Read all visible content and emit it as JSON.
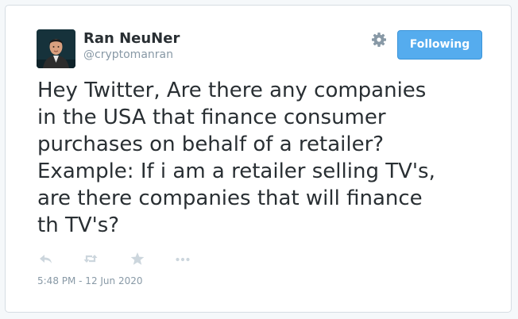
{
  "author": {
    "name": "Ran NeuNer",
    "handle": "@cryptomanran"
  },
  "follow_button": {
    "label": "Following"
  },
  "tweet": {
    "text": "Hey Twitter, Are there any companies\nin the USA that finance consumer\npurchases on behalf of a retailer?\nExample: If i am a retailer selling TV's,\nare there companies that will finance\nth TV's?",
    "timestamp": "5:48 PM - 12 Jun 2020"
  },
  "icons": {
    "settings": "gear-icon",
    "reply": "reply-icon",
    "retweet": "retweet-icon",
    "favorite": "star-icon",
    "more": "more-icon"
  },
  "colors": {
    "accent": "#55acee",
    "text": "#292f33",
    "muted": "#8899a6",
    "action_icons": "#ccd6dd"
  }
}
